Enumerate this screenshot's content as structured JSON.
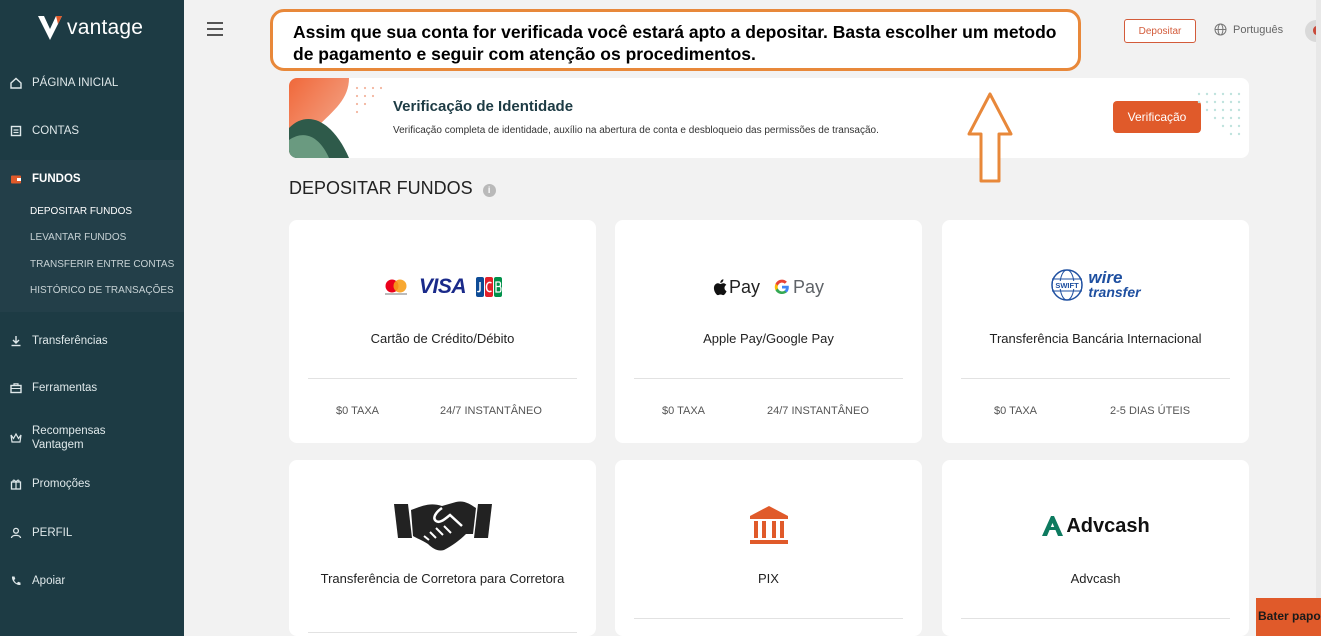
{
  "brand": {
    "name": "vantage"
  },
  "sidebar": {
    "items": [
      {
        "label": "PÁGINA INICIAL",
        "icon": "home-icon"
      },
      {
        "label": "CONTAS",
        "icon": "accounts-icon"
      },
      {
        "label": "FUNDOS",
        "icon": "wallet-icon",
        "active": true
      },
      {
        "label": "Transferências",
        "icon": "download-icon"
      },
      {
        "label": "Ferramentas",
        "icon": "briefcase-icon"
      },
      {
        "label": "Recompensas Vantagem",
        "icon": "crown-icon"
      },
      {
        "label": "Promoções",
        "icon": "gift-icon"
      },
      {
        "label": "PERFIL",
        "icon": "user-icon"
      },
      {
        "label": "Apoiar",
        "icon": "phone-icon"
      }
    ],
    "sub_items": [
      {
        "label": "DEPOSITAR FUNDOS",
        "active": true
      },
      {
        "label": "LEVANTAR FUNDOS"
      },
      {
        "label": "TRANSFERIR ENTRE CONTAS"
      },
      {
        "label": "HISTÓRICO DE TRANSAÇÕES"
      }
    ]
  },
  "topbar": {
    "callout_text": "Assim que sua conta for verificada você estará apto a depositar. Basta escolher um metodo de pagamento e seguir com atenção os procedimentos.",
    "deposit_button": "Depositar",
    "language": "Português"
  },
  "banner": {
    "title": "Verificação de Identidade",
    "description": "Verificação completa de identidade, auxílio na abertura de conta e desbloqueio das permissões de transação.",
    "button": "Verificação"
  },
  "section": {
    "title": "DEPOSITAR FUNDOS",
    "info": "i"
  },
  "methods": [
    {
      "name": "Cartão de Crédito/Débito",
      "fee": "$0 TAXA",
      "time": "24/7 INSTANTÂNEO",
      "logo_text": [
        "VISA"
      ]
    },
    {
      "name": "Apple Pay/Google Pay",
      "fee": "$0 TAXA",
      "time": "24/7 INSTANTÂNEO",
      "logo_text": [
        "Pay",
        "Pay"
      ]
    },
    {
      "name": "Transferência Bancária Internacional",
      "fee": "$0 TAXA",
      "time": "2-5 DIAS ÚTEIS",
      "logo_text": [
        "SWIFT",
        "wire",
        "transfer"
      ]
    },
    {
      "name": "Transferência de Corretora para Corretora"
    },
    {
      "name": "PIX"
    },
    {
      "name": "Advcash",
      "logo_text": [
        "Advcash"
      ]
    }
  ],
  "chat": {
    "label": "Bater papo"
  },
  "colors": {
    "sidebar": "#1d3b44",
    "accent": "#e05a2a",
    "callout_border": "#e8883a"
  }
}
